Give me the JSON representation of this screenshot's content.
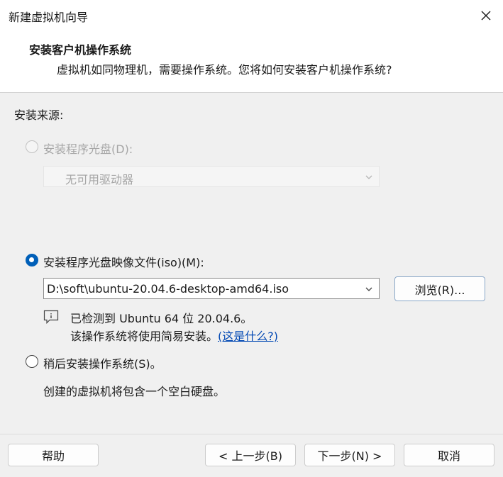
{
  "window": {
    "title": "新建虚拟机向导"
  },
  "header": {
    "title": "安装客户机操作系统",
    "subtitle": "虚拟机如同物理机，需要操作系统。您将如何安装客户机操作系统?"
  },
  "source_label": "安装来源:",
  "options": {
    "disc": {
      "label": "安装程序光盘(D):",
      "dropdown_value": "无可用驱动器",
      "selected": false,
      "enabled": false
    },
    "iso": {
      "label": "安装程序光盘映像文件(iso)(M):",
      "path_value": "D:\\soft\\ubuntu-20.04.6-desktop-amd64.iso",
      "browse_label": "浏览(R)...",
      "selected": true
    },
    "later": {
      "label": "稍后安装操作系统(S)。",
      "description": "创建的虚拟机将包含一个空白硬盘。",
      "selected": false
    }
  },
  "detection": {
    "line1": "已检测到 Ubuntu 64 位 20.04.6。",
    "line2": "该操作系统将使用简易安装。",
    "link": "(这是什么?)"
  },
  "buttons": {
    "help": "帮助",
    "back": "< 上一步(B)",
    "next": "下一步(N) >",
    "cancel": "取消"
  },
  "colors": {
    "accent": "#005fb8",
    "link": "#0047b3",
    "disabled_text": "#a6a6a6"
  }
}
